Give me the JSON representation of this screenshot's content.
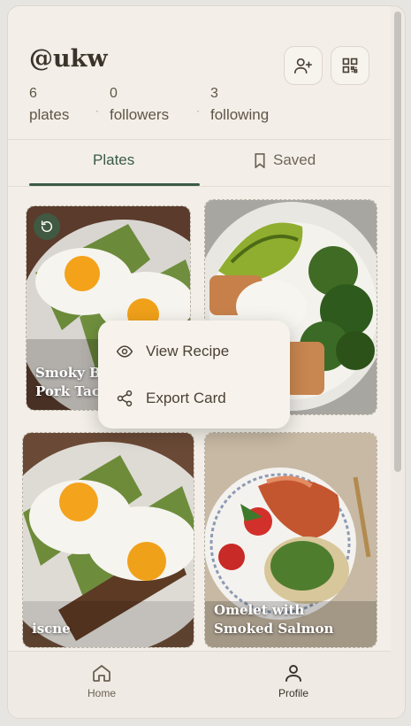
{
  "profile": {
    "handle": "@ukw",
    "stats": [
      {
        "value": "6",
        "label": "plates"
      },
      {
        "value": "0",
        "label": "followers"
      },
      {
        "value": "3",
        "label": "following"
      }
    ],
    "actions": {
      "add_friend_icon": "add-user-icon",
      "qr_icon": "qr-code-icon"
    }
  },
  "tabs": [
    {
      "label": "Plates",
      "active": true
    },
    {
      "label": "Saved",
      "active": false,
      "icon": "bookmark-icon"
    }
  ],
  "plates": [
    {
      "title": "Smoky BBQ Pork Tacos",
      "visible_title": "Smoky BB\nPork Taco",
      "reposted": true
    },
    {
      "title": ""
    },
    {
      "title": "iscne"
    },
    {
      "title": "Omelet with Smoked Salmon"
    }
  ],
  "context_menu": {
    "items": [
      {
        "label": "View Recipe",
        "icon": "eye-icon"
      },
      {
        "label": "Export Card",
        "icon": "share-icon"
      }
    ]
  },
  "bottom_nav": [
    {
      "label": "Home",
      "icon": "home-icon"
    },
    {
      "label": "Profile",
      "icon": "user-icon",
      "active": true
    }
  ],
  "colors": {
    "accent": "#3b5b45",
    "background": "#f3efe8",
    "text": "#3a3329"
  }
}
